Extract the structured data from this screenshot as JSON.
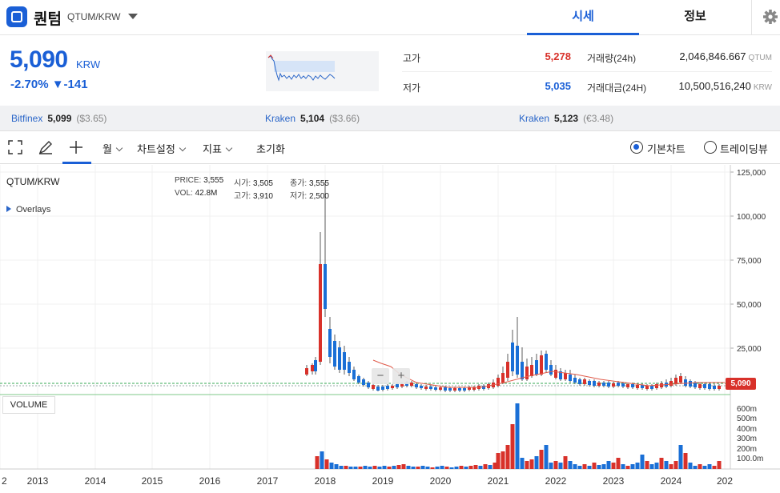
{
  "header": {
    "coin_name": "퀀텀",
    "pair": "QTUM/KRW",
    "tabs": [
      "시세",
      "정보"
    ]
  },
  "ticker": {
    "price": "5,090",
    "unit": "KRW",
    "change": "-2.70% ▼-141",
    "high_label": "고가",
    "high_value": "5,278",
    "low_label": "저가",
    "low_value": "5,035",
    "volume_label": "거래량(24h)",
    "volume_value": "2,046,846.667",
    "volume_unit": "QTUM",
    "amount_label": "거래대금(24H)",
    "amount_value": "10,500,516,240",
    "amount_unit": "KRW"
  },
  "exchanges": [
    {
      "name": "Bitfinex",
      "price": "5,099",
      "usd": "($3.65)"
    },
    {
      "name": "Kraken",
      "price": "5,104",
      "usd": "($3.66)"
    },
    {
      "name": "Kraken",
      "price": "5,123",
      "usd": "(€3.48)"
    }
  ],
  "toolbar": {
    "interval": "월",
    "chart_settings": "차트설정",
    "indicators": "지표",
    "reset": "초기화",
    "basic_chart": "기본차트",
    "trading_view": "트레이딩뷰"
  },
  "chart": {
    "symbol": "QTUM/KRW",
    "overlays": "Overlays",
    "price_label": "PRICE:",
    "price": "3,555",
    "open_label": "시가:",
    "open": "3,505",
    "close_label": "종가:",
    "close": "3,555",
    "vol_label": "VOL:",
    "vol": "42.8M",
    "high_label": "고가:",
    "high": "3,910",
    "low_label": "저가:",
    "low": "2,500",
    "volume_panel": "VOLUME",
    "last_price_tag": "5,090",
    "zoom_out": "−",
    "zoom_in": "+"
  },
  "colors": {
    "accent": "#1a5fd6",
    "up": "#d8312a",
    "down": "#1a6fd6"
  },
  "chart_data": {
    "type": "candlestick",
    "y_ticks": [
      "125,000",
      "100,000",
      "75,000",
      "50,000",
      "25,000"
    ],
    "vol_ticks": [
      "600m",
      "500m",
      "400m",
      "300m",
      "200m",
      "100.0m"
    ],
    "x_ticks": [
      "2",
      "2013",
      "2014",
      "2015",
      "2016",
      "2017",
      "2018",
      "2019",
      "2020",
      "2021",
      "2022",
      "2023",
      "2024",
      "202"
    ],
    "ylim": [
      0,
      125000
    ],
    "grid": true
  }
}
